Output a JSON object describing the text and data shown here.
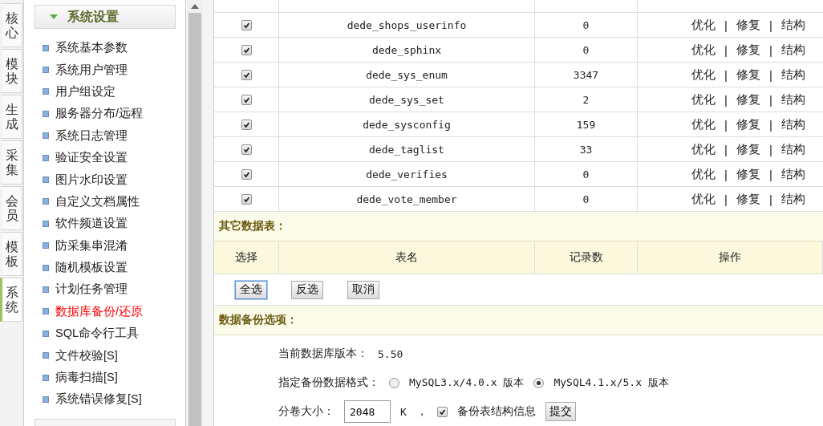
{
  "side_tabs": [
    {
      "label": "核心",
      "selected": false
    },
    {
      "label": "模块",
      "selected": false
    },
    {
      "label": "生成",
      "selected": false
    },
    {
      "label": "采集",
      "selected": false
    },
    {
      "label": "会员",
      "selected": false
    },
    {
      "label": "模板",
      "selected": false
    },
    {
      "label": "系统",
      "selected": true
    }
  ],
  "sidebar": {
    "title": "系统设置",
    "expanded": true,
    "items": [
      {
        "label": "系统基本参数",
        "selected": false
      },
      {
        "label": "系统用户管理",
        "selected": false
      },
      {
        "label": "用户组设定",
        "selected": false
      },
      {
        "label": "服务器分布/远程",
        "selected": false
      },
      {
        "label": "系统日志管理",
        "selected": false
      },
      {
        "label": "验证安全设置",
        "selected": false
      },
      {
        "label": "图片水印设置",
        "selected": false
      },
      {
        "label": "自定义文档属性",
        "selected": false
      },
      {
        "label": "软件频道设置",
        "selected": false
      },
      {
        "label": "防采集串混淆",
        "selected": false
      },
      {
        "label": "随机模板设置",
        "selected": false
      },
      {
        "label": "计划任务管理",
        "selected": false
      },
      {
        "label": "数据库备份/还原",
        "selected": true
      },
      {
        "label": "SQL命令行工具",
        "selected": false
      },
      {
        "label": "文件校验[S]",
        "selected": false
      },
      {
        "label": "病毒扫描[S]",
        "selected": false
      },
      {
        "label": "系统错误修复[S]",
        "selected": false
      }
    ]
  },
  "table": {
    "separator": "|",
    "rows": [
      {
        "checked": true,
        "name": "dede_shops_userinfo",
        "count": "0",
        "actions": [
          "优化",
          "修复",
          "结构"
        ]
      },
      {
        "checked": true,
        "name": "dede_sphinx",
        "count": "0",
        "actions": [
          "优化",
          "修复",
          "结构"
        ]
      },
      {
        "checked": true,
        "name": "dede_sys_enum",
        "count": "3347",
        "actions": [
          "优化",
          "修复",
          "结构"
        ]
      },
      {
        "checked": true,
        "name": "dede_sys_set",
        "count": "2",
        "actions": [
          "优化",
          "修复",
          "结构"
        ]
      },
      {
        "checked": true,
        "name": "dede_sysconfig",
        "count": "159",
        "actions": [
          "优化",
          "修复",
          "结构"
        ]
      },
      {
        "checked": true,
        "name": "dede_taglist",
        "count": "33",
        "actions": [
          "优化",
          "修复",
          "结构"
        ]
      },
      {
        "checked": true,
        "name": "dede_verifies",
        "count": "0",
        "actions": [
          "优化",
          "修复",
          "结构"
        ]
      },
      {
        "checked": true,
        "name": "dede_vote_member",
        "count": "0",
        "actions": [
          "优化",
          "修复",
          "结构"
        ]
      }
    ]
  },
  "other_tables": {
    "title": "其它数据表：",
    "columns": [
      "选择",
      "表名",
      "记录数",
      "操作"
    ]
  },
  "buttons": [
    {
      "label": "全选",
      "focused": true
    },
    {
      "label": "反选",
      "focused": false
    },
    {
      "label": "取消",
      "focused": false
    }
  ],
  "backup_options": {
    "title": "数据备份选项：",
    "db_version_label": "当前数据库版本：",
    "db_version": "5.50",
    "format_label": "指定备份数据格式：",
    "formats": [
      {
        "label": "MySQL3.x/4.0.x 版本",
        "selected": false
      },
      {
        "label": "MySQL4.1.x/5.x 版本",
        "selected": true
      }
    ],
    "volume_label": "分卷大小：",
    "volume_size": "2048",
    "volume_unit": "K",
    "volume_separator": "，",
    "include_structure": {
      "label": "备份表结构信息",
      "checked": true
    },
    "submit": "提交"
  }
}
